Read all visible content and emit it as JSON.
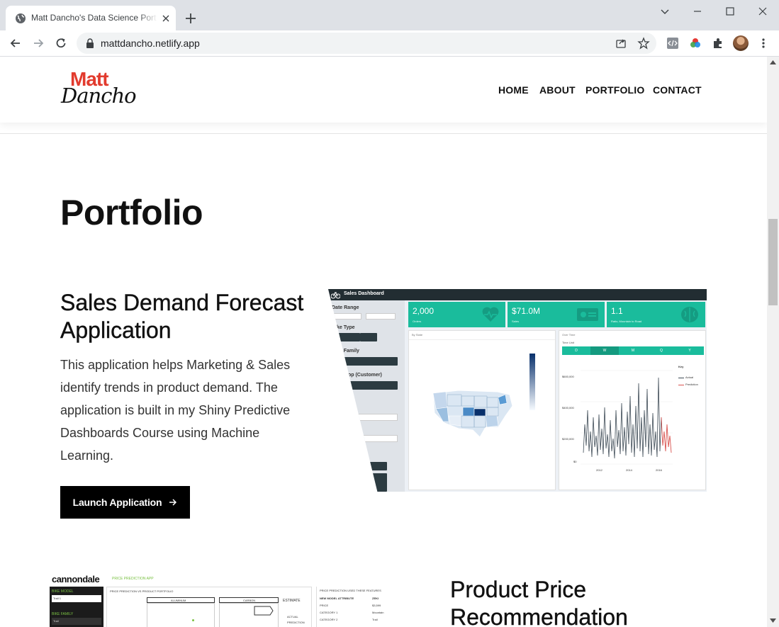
{
  "browser": {
    "tab_title": "Matt Dancho's Data Science Portfolio",
    "url": "mattdancho.netlify.app"
  },
  "site": {
    "logo_top": "Matt",
    "logo_script": "Dancho",
    "nav": [
      "HOME",
      "ABOUT",
      "PORTFOLIO",
      "CONTACT"
    ]
  },
  "page": {
    "title": "Portfolio"
  },
  "projects": [
    {
      "title_line1": "Sales Demand Forecast",
      "title_line2": "Application",
      "description": "This application helps Marketing & Sales identify trends in product demand. The application is built in my Shiny Predictive Dashboards Course using Machine Learning.",
      "button_label": "Launch Application",
      "screenshot": {
        "header": "Sales Dashboard",
        "sidebar_labels": [
          "Date Range",
          "Bike Type",
          "Bike Family",
          "Bikeshop (Customer)"
        ],
        "kpis": [
          {
            "value": "2,000",
            "label": "Orders"
          },
          {
            "value": "$71.0M",
            "label": "Sales"
          },
          {
            "value": "1.1",
            "label": "Ratio, Mountain to Road"
          }
        ],
        "map_label": "By State",
        "chart_label": "Over Time",
        "time_unit_label": "Time Unit",
        "time_units": [
          "D",
          "W",
          "M",
          "Q",
          "Y"
        ],
        "legend_title": "Key",
        "legend_items": [
          "Actual",
          "Prediction"
        ],
        "y_ticks": [
          "$600,000",
          "$400,000",
          "$200,000",
          "$0"
        ],
        "x_ticks": [
          "2012",
          "2014",
          "2016"
        ]
      }
    },
    {
      "title_line1": "Product Price",
      "title_line2": "Recommendation",
      "screenshot": {
        "brand": "cannondale",
        "app_name": "PRICE PREDICTION APP",
        "labels": [
          "BIKE MODEL",
          "BIKE FAMILY"
        ],
        "model_value": "Trail 1",
        "family_value": "Trail",
        "mid_title": "PRICE PREDICTION VS PRODUCT PORTFOLIO",
        "groups": [
          "ALUMINUM",
          "CARBON"
        ],
        "estimate_label": "ESTIMATE",
        "legend_items": [
          "ACTUAL",
          "PREDICTION"
        ],
        "table_title": "PRICE PREDICTION USED THESE FEATURES",
        "table_header": [
          "NEW MODEL ATTRIBUTE",
          "ZEKI"
        ],
        "table_rows": [
          [
            "PRICE",
            "$3,599"
          ],
          [
            "CATEGORY 1",
            "Mountain"
          ],
          [
            "CATEGORY 2",
            "Trail"
          ]
        ]
      }
    }
  ]
}
